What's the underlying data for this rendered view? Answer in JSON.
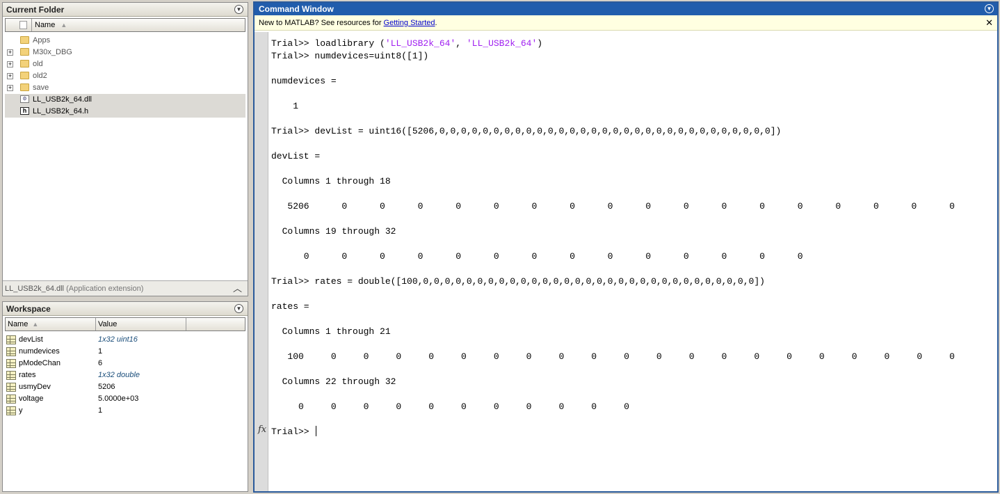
{
  "current_folder": {
    "title": "Current Folder",
    "name_header": "Name",
    "sort_indicator": "▲",
    "items": [
      {
        "name": "Apps",
        "expandable": false,
        "icon": "folder-icon"
      },
      {
        "name": "M30x_DBG",
        "expandable": true,
        "icon": "folder-icon"
      },
      {
        "name": "old",
        "expandable": true,
        "icon": "folder-icon"
      },
      {
        "name": "old2",
        "expandable": true,
        "icon": "folder-icon"
      },
      {
        "name": "save",
        "expandable": true,
        "icon": "folder-icon"
      },
      {
        "name": "LL_USB2k_64.dll",
        "expandable": false,
        "icon": "dll-file-icon"
      },
      {
        "name": "LL_USB2k_64.h",
        "expandable": false,
        "icon": "header-file-icon"
      }
    ],
    "status_file": "LL_USB2k_64.dll",
    "status_desc": "(Application extension)"
  },
  "workspace": {
    "title": "Workspace",
    "name_header": "Name",
    "value_header": "Value",
    "sort_indicator": "▲",
    "variables": [
      {
        "name": "devList",
        "value": "1x32 uint16",
        "italic": true
      },
      {
        "name": "numdevices",
        "value": "1",
        "italic": false
      },
      {
        "name": "pModeChan",
        "value": "6",
        "italic": false
      },
      {
        "name": "rates",
        "value": "1x32 double",
        "italic": true
      },
      {
        "name": "usmyDev",
        "value": "5206",
        "italic": false
      },
      {
        "name": "voltage",
        "value": "5.0000e+03",
        "italic": false
      },
      {
        "name": "y",
        "value": "1",
        "italic": false
      }
    ]
  },
  "command_window": {
    "title": "Command Window",
    "info_text": "New to MATLAB? See resources for ",
    "info_link": "Getting Started",
    "info_end": ".",
    "close_symbol": "✕",
    "lines": [
      {
        "parts": [
          {
            "t": "Trial>> loadlibrary ("
          },
          {
            "t": "'LL_USB2k_64'",
            "s": true
          },
          {
            "t": ", "
          },
          {
            "t": "'LL_USB2k_64'",
            "s": true
          },
          {
            "t": ")"
          }
        ]
      },
      {
        "parts": [
          {
            "t": "Trial>> numdevices=uint8([1])"
          }
        ]
      },
      {
        "parts": [
          {
            "t": ""
          }
        ]
      },
      {
        "parts": [
          {
            "t": "numdevices ="
          }
        ]
      },
      {
        "parts": [
          {
            "t": ""
          }
        ]
      },
      {
        "parts": [
          {
            "t": "    1"
          }
        ]
      },
      {
        "parts": [
          {
            "t": ""
          }
        ]
      },
      {
        "parts": [
          {
            "t": "Trial>> devList = uint16([5206,0,0,0,0,0,0,0,0,0,0,0,0,0,0,0,0,0,0,0,0,0,0,0,0,0,0,0,0,0,0,0])"
          }
        ]
      },
      {
        "parts": [
          {
            "t": ""
          }
        ]
      },
      {
        "parts": [
          {
            "t": "devList ="
          }
        ]
      },
      {
        "parts": [
          {
            "t": ""
          }
        ]
      },
      {
        "parts": [
          {
            "t": "  Columns 1 through 18"
          }
        ]
      },
      {
        "parts": [
          {
            "t": ""
          }
        ]
      },
      {
        "parts": [
          {
            "t": "   5206      0      0      0      0      0      0      0      0      0      0      0      0      0      0      0      0      0"
          }
        ]
      },
      {
        "parts": [
          {
            "t": ""
          }
        ]
      },
      {
        "parts": [
          {
            "t": "  Columns 19 through 32"
          }
        ]
      },
      {
        "parts": [
          {
            "t": ""
          }
        ]
      },
      {
        "parts": [
          {
            "t": "      0      0      0      0      0      0      0      0      0      0      0      0      0      0"
          }
        ]
      },
      {
        "parts": [
          {
            "t": ""
          }
        ]
      },
      {
        "parts": [
          {
            "t": "Trial>> rates = double([100,0,0,0,0,0,0,0,0,0,0,0,0,0,0,0,0,0,0,0,0,0,0,0,0,0,0,0,0,0,0,0])"
          }
        ]
      },
      {
        "parts": [
          {
            "t": ""
          }
        ]
      },
      {
        "parts": [
          {
            "t": "rates ="
          }
        ]
      },
      {
        "parts": [
          {
            "t": ""
          }
        ]
      },
      {
        "parts": [
          {
            "t": "  Columns 1 through 21"
          }
        ]
      },
      {
        "parts": [
          {
            "t": ""
          }
        ]
      },
      {
        "parts": [
          {
            "t": "   100     0     0     0     0     0     0     0     0     0     0     0     0     0     0     0     0     0     0     0     0"
          }
        ]
      },
      {
        "parts": [
          {
            "t": ""
          }
        ]
      },
      {
        "parts": [
          {
            "t": "  Columns 22 through 32"
          }
        ]
      },
      {
        "parts": [
          {
            "t": ""
          }
        ]
      },
      {
        "parts": [
          {
            "t": "     0     0     0     0     0     0     0     0     0     0     0"
          }
        ]
      },
      {
        "parts": [
          {
            "t": ""
          }
        ]
      },
      {
        "parts": [
          {
            "t": "Trial>> "
          }
        ],
        "cursor": true
      }
    ],
    "fx_symbol": "fx"
  }
}
